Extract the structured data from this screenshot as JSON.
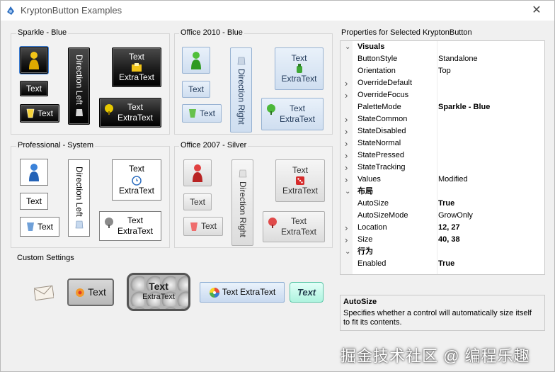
{
  "window": {
    "title": "KryptonButton Examples",
    "close_glyph": "✕"
  },
  "groups": {
    "sparkle": "Sparkle - Blue",
    "office2010": "Office 2010 - Blue",
    "professional": "Professional - System",
    "office2007": "Office 2007 - Silver",
    "custom": "Custom Settings"
  },
  "buttons": {
    "text": "Text",
    "extra": "ExtraText",
    "dir_left": "Direction  Left",
    "dir_right": "Direction  Right",
    "text_extra_inline": "Text  ExtraText"
  },
  "properties": {
    "title": "Properties for Selected KryptonButton",
    "rows": [
      {
        "type": "category",
        "name": "Visuals"
      },
      {
        "type": "prop",
        "name": "ButtonStyle",
        "value": "Standalone",
        "bold": false,
        "expander": false
      },
      {
        "type": "prop",
        "name": "Orientation",
        "value": "Top",
        "bold": false,
        "expander": false
      },
      {
        "type": "prop",
        "name": "OverrideDefault",
        "value": "",
        "bold": false,
        "expander": true
      },
      {
        "type": "prop",
        "name": "OverrideFocus",
        "value": "",
        "bold": false,
        "expander": true
      },
      {
        "type": "prop",
        "name": "PaletteMode",
        "value": "Sparkle - Blue",
        "bold": true,
        "expander": false
      },
      {
        "type": "prop",
        "name": "StateCommon",
        "value": "",
        "bold": false,
        "expander": true
      },
      {
        "type": "prop",
        "name": "StateDisabled",
        "value": "",
        "bold": false,
        "expander": true
      },
      {
        "type": "prop",
        "name": "StateNormal",
        "value": "",
        "bold": false,
        "expander": true
      },
      {
        "type": "prop",
        "name": "StatePressed",
        "value": "",
        "bold": false,
        "expander": true
      },
      {
        "type": "prop",
        "name": "StateTracking",
        "value": "",
        "bold": false,
        "expander": true
      },
      {
        "type": "prop",
        "name": "Values",
        "value": "Modified",
        "bold": false,
        "expander": true
      },
      {
        "type": "category",
        "name": "布局"
      },
      {
        "type": "prop",
        "name": "AutoSize",
        "value": "True",
        "bold": true,
        "expander": false
      },
      {
        "type": "prop",
        "name": "AutoSizeMode",
        "value": "GrowOnly",
        "bold": false,
        "expander": false
      },
      {
        "type": "prop",
        "name": "Location",
        "value": "12, 27",
        "bold": true,
        "expander": true
      },
      {
        "type": "prop",
        "name": "Size",
        "value": "40, 38",
        "bold": true,
        "expander": true
      },
      {
        "type": "category",
        "name": "行为"
      },
      {
        "type": "prop",
        "name": "Enabled",
        "value": "True",
        "bold": true,
        "expander": false
      }
    ],
    "desc_title": "AutoSize",
    "desc_text": "Specifies whether a control will automatically size itself to fit its contents."
  },
  "watermark": "掘金技术社区 @ 编程乐趣",
  "colors": {
    "sparkle_bg": "#1b1b1b",
    "office2010_bg": "#cfdef0",
    "accent_blue": "#2f6fc0"
  }
}
